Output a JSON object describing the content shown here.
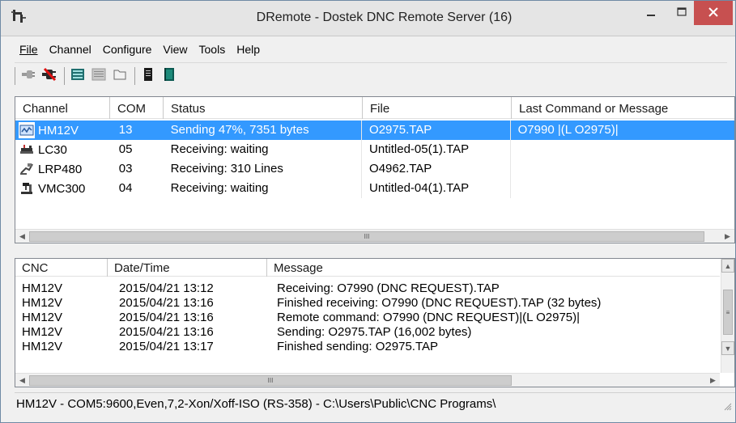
{
  "window": {
    "title": "DRemote - Dostek DNC Remote Server (16)"
  },
  "menu": [
    "File",
    "Channel",
    "Configure",
    "View",
    "Tools",
    "Help"
  ],
  "menu_hotkeys": [
    "F",
    "C",
    "f",
    "V",
    "T",
    "H"
  ],
  "toolbar": {
    "icons": [
      "plug-icon",
      "disconnect-icon",
      "list-view-icon",
      "details-view-icon",
      "folder-icon",
      "document-icon",
      "book-icon"
    ]
  },
  "channels": {
    "headers": [
      "Channel",
      "COM",
      "Status",
      "File",
      "Last Command or Message"
    ],
    "rows": [
      {
        "channel": "HM12V",
        "com": "13",
        "status": "Sending 47%, 7351 bytes",
        "file": "O2975.TAP",
        "last": "O7990 |(L O2975)|",
        "icon": "sending-icon",
        "selected": true
      },
      {
        "channel": "LC30",
        "com": "05",
        "status": "Receiving: waiting",
        "file": "Untitled-05(1).TAP",
        "last": "",
        "icon": "lathe-icon",
        "selected": false
      },
      {
        "channel": "LRP480",
        "com": "03",
        "status": "Receiving: 310 Lines",
        "file": "O4962.TAP",
        "last": "",
        "icon": "router-icon",
        "selected": false
      },
      {
        "channel": "VMC300",
        "com": "04",
        "status": "Receiving: waiting",
        "file": "Untitled-04(1).TAP",
        "last": "",
        "icon": "mill-icon",
        "selected": false
      }
    ],
    "hscroll_grip": "III"
  },
  "log": {
    "headers": [
      "CNC",
      "Date/Time",
      "Message"
    ],
    "rows": [
      {
        "cnc": "HM12V",
        "datetime": "2015/04/21 13:12",
        "message": "Receiving: O7990 (DNC REQUEST).TAP"
      },
      {
        "cnc": "HM12V",
        "datetime": "2015/04/21 13:16",
        "message": "Finished receiving: O7990 (DNC REQUEST).TAP (32 bytes)"
      },
      {
        "cnc": "HM12V",
        "datetime": "2015/04/21 13:16",
        "message": "Remote command: O7990 (DNC REQUEST)|(L O2975)|"
      },
      {
        "cnc": "HM12V",
        "datetime": "2015/04/21 13:16",
        "message": "Sending: O2975.TAP (16,002 bytes)"
      },
      {
        "cnc": "HM12V",
        "datetime": "2015/04/21 13:17",
        "message": "Finished sending: O2975.TAP"
      }
    ],
    "hscroll_grip": "III",
    "vscroll_grip": "≡"
  },
  "statusbar": {
    "text": "HM12V - COM5:9600,Even,7,2-Xon/Xoff-ISO (RS-358) - C:\\Users\\Public\\CNC Programs\\"
  },
  "colors": {
    "selection": "#3399ff",
    "close_button": "#c75050"
  }
}
